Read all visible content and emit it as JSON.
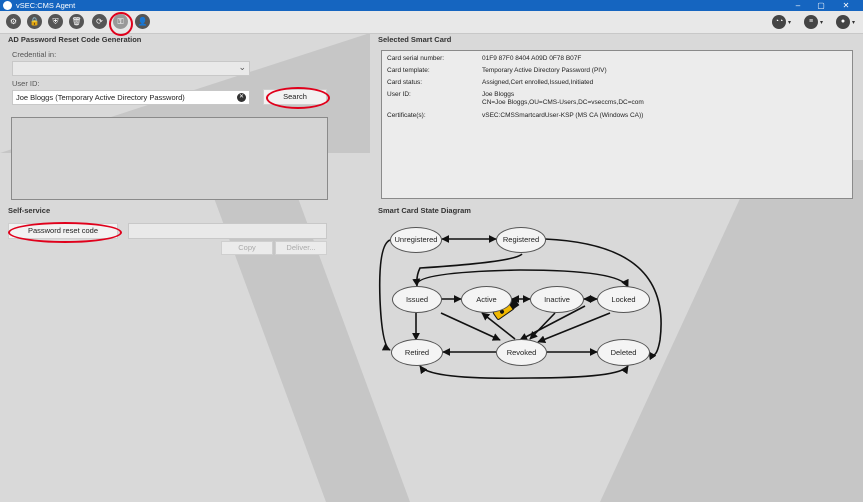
{
  "window": {
    "title": "vSEC:CMS Agent",
    "minimize": "–",
    "maximize": "▢",
    "close": "✕"
  },
  "toolbar": {
    "buttons": [
      {
        "name": "operations",
        "icon": "⚙"
      },
      {
        "name": "lock",
        "icon": "🔒"
      },
      {
        "name": "shield",
        "icon": "⛨"
      },
      {
        "name": "trash",
        "icon": "🗑"
      },
      {
        "name": "sync",
        "icon": "⟳"
      },
      {
        "name": "password-reset",
        "icon": "⚿"
      },
      {
        "name": "user-card",
        "icon": "👤"
      }
    ],
    "right": [
      {
        "name": "view-glasses",
        "icon": "◔◔",
        "caret": "▾"
      },
      {
        "name": "list",
        "icon": "≡",
        "caret": "▾"
      },
      {
        "name": "account",
        "icon": "●",
        "caret": "▾"
      }
    ]
  },
  "reset_section": {
    "title": "AD Password Reset Code Generation",
    "credential_label": "Credential in:",
    "credential_value": "",
    "dropdown_caret": "⌄",
    "userid_label": "User ID:",
    "userid_value": "Joe Bloggs (Temporary Active Directory Password)",
    "clear_icon": "✕",
    "search_label": "Search"
  },
  "self_service": {
    "title": "Self-service",
    "password_reset_label": "Password reset code",
    "code_value": "",
    "copy_label": "Copy",
    "deliver_label": "Deliver..."
  },
  "selected_card": {
    "title": "Selected Smart Card",
    "rows": [
      {
        "label": "Card serial number:",
        "value": "01F9 87F0 8404 A09D 0F78 B07F"
      },
      {
        "label": "Card template:",
        "value": "Temporary Active Directory Password (PIV)"
      },
      {
        "label": "Card status:",
        "value": "Assigned,Cert enrolled,Issued,Initiated"
      },
      {
        "label": "User ID:",
        "value": "Joe Bloggs",
        "value2": "CN=Joe Bloggs,OU=CMS-Users,DC=vseccms,DC=com"
      },
      {
        "label": "Certificate(s):",
        "value": "vSEC:CMSSmartcardUser-KSP (MS CA (Windows CA))"
      }
    ]
  },
  "diagram": {
    "title": "Smart Card State Diagram",
    "states": {
      "unregistered": "Unregistered",
      "registered": "Registered",
      "issued": "Issued",
      "active": "Active",
      "inactive": "Inactive",
      "locked": "Locked",
      "retired": "Retired",
      "revoked": "Revoked",
      "deleted": "Deleted"
    }
  },
  "colors": {
    "accent": "#1565c0",
    "highlight": "#e0001b",
    "token": "#f0b800"
  }
}
